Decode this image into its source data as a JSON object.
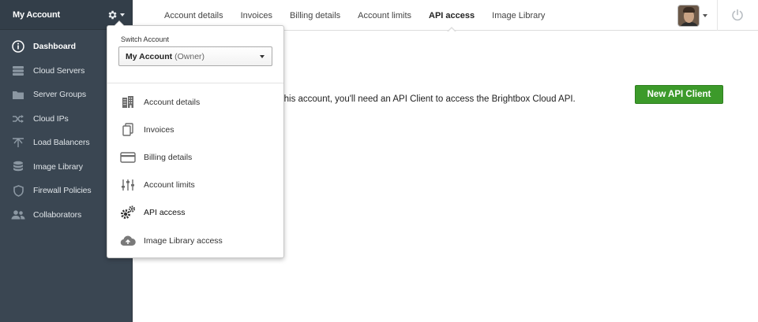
{
  "sidebar": {
    "account_name": "My Account",
    "items": [
      {
        "label": "Dashboard",
        "icon": "info-icon"
      },
      {
        "label": "Cloud Servers",
        "icon": "servers-icon"
      },
      {
        "label": "Server Groups",
        "icon": "folder-icon"
      },
      {
        "label": "Cloud IPs",
        "icon": "shuffle-icon"
      },
      {
        "label": "Load Balancers",
        "icon": "load-balancer-icon"
      },
      {
        "label": "Image Library",
        "icon": "database-icon"
      },
      {
        "label": "Firewall Policies",
        "icon": "shield-icon"
      },
      {
        "label": "Collaborators",
        "icon": "users-icon"
      }
    ]
  },
  "topnav": {
    "tabs": [
      {
        "label": "Account details"
      },
      {
        "label": "Invoices"
      },
      {
        "label": "Billing details"
      },
      {
        "label": "Account limits"
      },
      {
        "label": "API access"
      },
      {
        "label": "Image Library"
      }
    ],
    "active_tab": "API access"
  },
  "main": {
    "description": "or this account, you'll need an API Client to access the Brightbox Cloud API.",
    "new_button_label": "New API Client"
  },
  "dropdown": {
    "switch_label": "Switch Account",
    "selected_account": "My Account",
    "selected_role": "(Owner)",
    "items": [
      {
        "label": "Account details",
        "icon": "building-icon"
      },
      {
        "label": "Invoices",
        "icon": "documents-icon"
      },
      {
        "label": "Billing details",
        "icon": "credit-card-icon"
      },
      {
        "label": "Account limits",
        "icon": "sliders-icon"
      },
      {
        "label": "API access",
        "icon": "gears-icon"
      },
      {
        "label": "Image Library access",
        "icon": "cloud-upload-icon"
      }
    ]
  },
  "colors": {
    "sidebar_bg": "#3a4652",
    "primary_green": "#3c9a2a"
  }
}
